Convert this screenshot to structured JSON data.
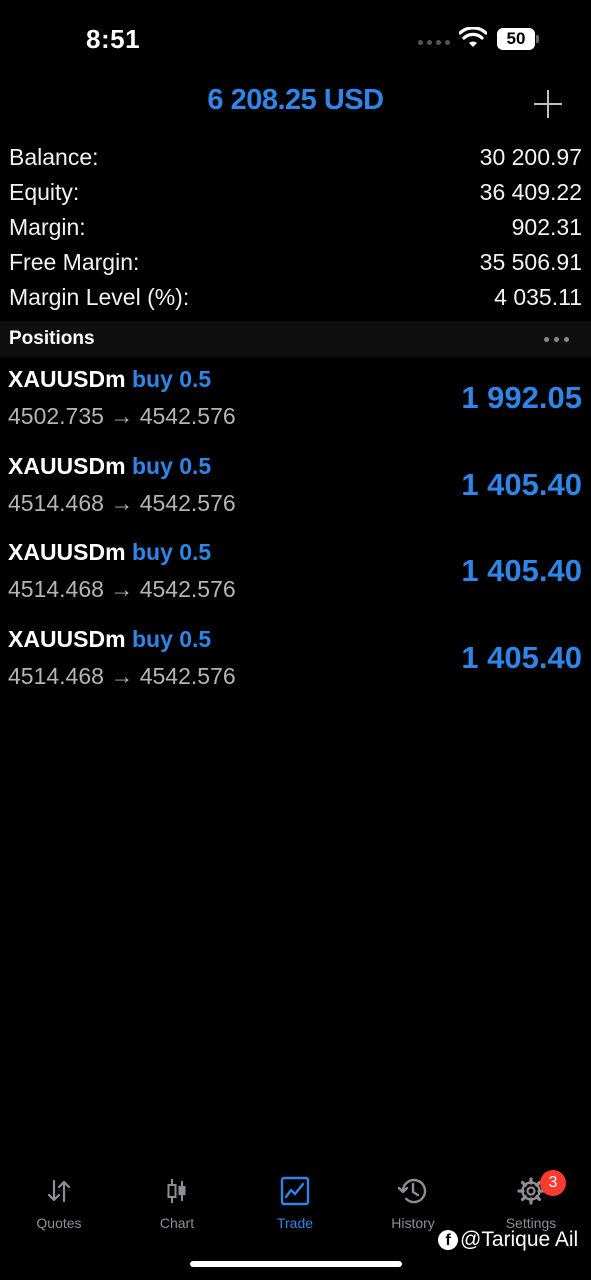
{
  "status_bar": {
    "time": "8:51",
    "battery": "50"
  },
  "header": {
    "title": "6 208.25 USD"
  },
  "account": {
    "rows": [
      {
        "label": "Balance:",
        "value": "30 200.97"
      },
      {
        "label": "Equity:",
        "value": "36 409.22"
      },
      {
        "label": "Margin:",
        "value": "902.31"
      },
      {
        "label": "Free Margin:",
        "value": "35 506.91"
      },
      {
        "label": "Margin Level (%):",
        "value": "4 035.11"
      }
    ]
  },
  "positions": {
    "title": "Positions",
    "items": [
      {
        "symbol": "XAUUSDm",
        "side": "buy 0.5",
        "open_price": "4502.735",
        "arrow": "→",
        "current_price": "4542.576",
        "profit": "1 992.05"
      },
      {
        "symbol": "XAUUSDm",
        "side": "buy 0.5",
        "open_price": "4514.468",
        "arrow": "→",
        "current_price": "4542.576",
        "profit": "1 405.40"
      },
      {
        "symbol": "XAUUSDm",
        "side": "buy 0.5",
        "open_price": "4514.468",
        "arrow": "→",
        "current_price": "4542.576",
        "profit": "1 405.40"
      },
      {
        "symbol": "XAUUSDm",
        "side": "buy 0.5",
        "open_price": "4514.468",
        "arrow": "→",
        "current_price": "4542.576",
        "profit": "1 405.40"
      }
    ]
  },
  "tabs": [
    {
      "label": "Quotes",
      "icon": "quotes-icon"
    },
    {
      "label": "Chart",
      "icon": "chart-icon"
    },
    {
      "label": "Trade",
      "icon": "trade-icon",
      "active": true
    },
    {
      "label": "History",
      "icon": "history-icon"
    },
    {
      "label": "Settings",
      "icon": "settings-icon",
      "badge": "3"
    }
  ],
  "watermark": "@Tarique Ail",
  "colors": {
    "accent": "#2e86e8",
    "badge": "#ff3b30",
    "inactive": "#8e8e93"
  }
}
